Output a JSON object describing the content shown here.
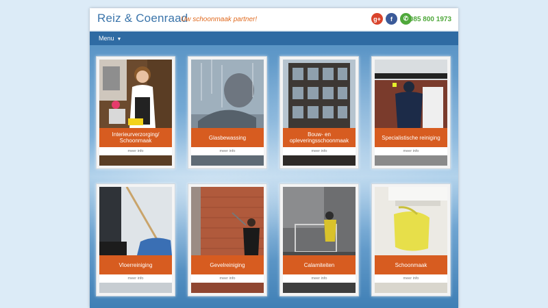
{
  "header": {
    "brand": "Reiz & Coenraad",
    "tagline": "Uw schoonmaak partner!",
    "phone": "085 800 1973",
    "social": [
      {
        "icon": "google-plus-icon",
        "glyph": "g+"
      },
      {
        "icon": "facebook-icon",
        "glyph": "f"
      },
      {
        "icon": "whatsapp-icon",
        "glyph": "✆"
      }
    ]
  },
  "nav": {
    "menu_label": "Menu",
    "caret": "▼"
  },
  "services": [
    {
      "title": "Interieurverzorging/ Schoonmaak",
      "more": "meer info"
    },
    {
      "title": "Glasbewassing",
      "more": "meer info"
    },
    {
      "title": "Bouw- en opleveringsschoonmaak",
      "more": "meer info"
    },
    {
      "title": "Specialistische reiniging",
      "more": "meer info"
    },
    {
      "title": "Vloerreiniging",
      "more": "meer info"
    },
    {
      "title": "Gevelreiniging",
      "more": "meer info"
    },
    {
      "title": "Calamiteiten",
      "more": "meer info"
    },
    {
      "title": "Schoonmaak",
      "more": "meer info"
    }
  ],
  "colors": {
    "brand": "#3a74aa",
    "accent": "#d75c20",
    "nav": "#2f6ba3",
    "phone": "#4fa83b"
  }
}
